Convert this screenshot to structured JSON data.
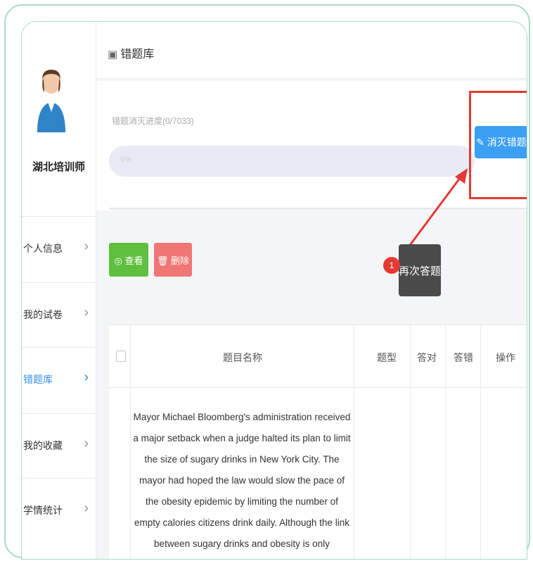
{
  "sidebar": {
    "user_name": "湖北培训师",
    "items": [
      {
        "label": "个人信息",
        "active": false
      },
      {
        "label": "我的试卷",
        "active": false
      },
      {
        "label": "错题库",
        "active": true
      },
      {
        "label": "我的收藏",
        "active": false
      },
      {
        "label": "学情统计",
        "active": false
      }
    ],
    "chevron": "›"
  },
  "header": {
    "icon": "calendar-icon",
    "title": "错题库"
  },
  "progress": {
    "label": "错题消灭进度(0/7033)",
    "percent_text": "0%",
    "value": 0
  },
  "actions": {
    "eliminate_label": "✎ 消灭错题",
    "view_label": "◎ 查看",
    "delete_label": "🗑 删除"
  },
  "annotation": {
    "step_number": "1",
    "tooltip_text": "再次答题",
    "highlight_color": "#e53935"
  },
  "table": {
    "columns": [
      "题目名称",
      "题型",
      "答对",
      "答错",
      "操作"
    ],
    "rows": [
      {
        "question": "Mayor Michael Bloomberg's administration received a major setback when a judge halted its plan to limit the size of sugary drinks in New York City. The mayor had hoped the law would slow the pace of the obesity epidemic by limiting the number of empty calories citizens drink daily. Although the link between sugary drinks and obesity is only circumstantial,"
      }
    ]
  },
  "colors": {
    "accent_blue": "#3b9ff3",
    "view_green": "#5fbf3f",
    "delete_red": "#f07676",
    "frame_green": "#a8dcc2"
  }
}
